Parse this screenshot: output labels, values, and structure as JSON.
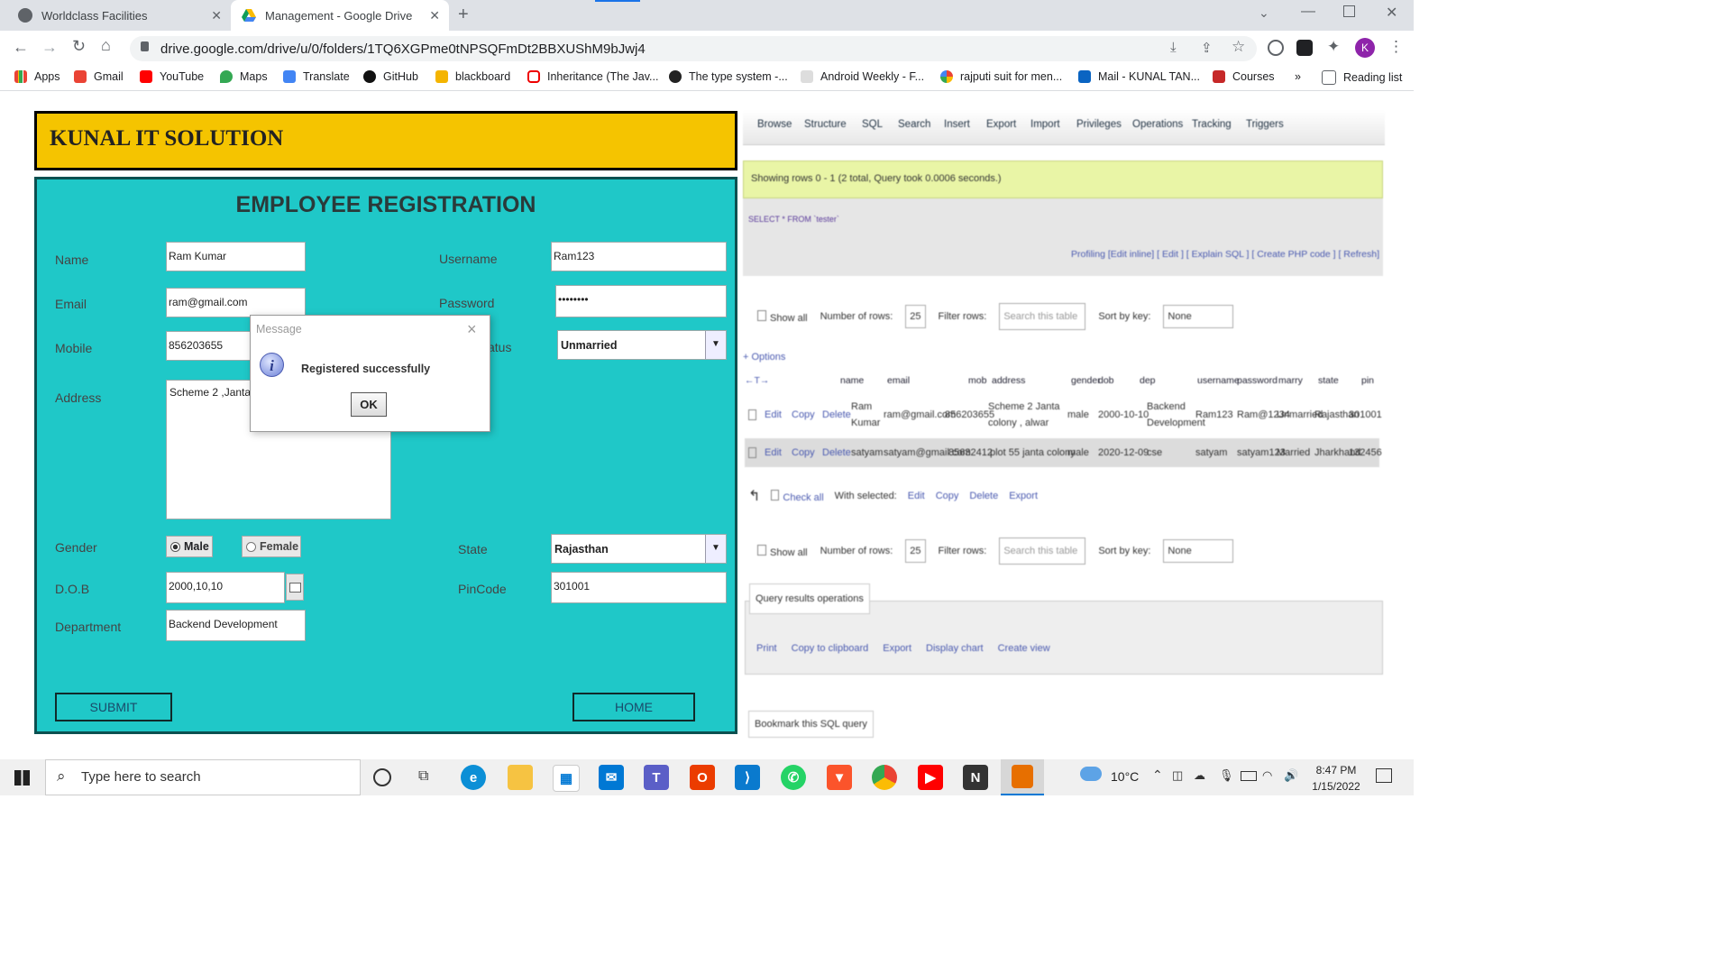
{
  "browser": {
    "tabs": [
      {
        "title": "Worldclass Facilities",
        "active": false
      },
      {
        "title": "Management - Google Drive",
        "active": true
      }
    ],
    "url": "drive.google.com/drive/u/0/folders/1TQ6XGPme0tNPSQFmDt2BBXUShM9bJwj4",
    "profile_initial": "K",
    "bookmarks": [
      "Apps",
      "Gmail",
      "YouTube",
      "Maps",
      "Translate",
      "GitHub",
      "blackboard",
      "Inheritance (The Jav...",
      "The type system -...",
      "Android Weekly - F...",
      "rajputi suit for men...",
      "Mail - KUNAL TAN...",
      "Courses"
    ],
    "reading_list": "Reading list",
    "more": "»"
  },
  "app": {
    "company": "KUNAL IT SOLUTION",
    "form_title": "EMPLOYEE REGISTRATION",
    "labels": {
      "name": "Name",
      "email": "Email",
      "mobile": "Mobile",
      "address": "Address",
      "gender": "Gender",
      "dob": "D.O.B",
      "department": "Department",
      "username": "Username",
      "password": "Password",
      "status": "atus",
      "state": "State",
      "pincode": "PinCode"
    },
    "values": {
      "name": "Ram Kumar",
      "email": "ram@gmail.com",
      "mobile": "856203655",
      "address": "Scheme 2 ,Janta",
      "dob": "2000,10,10",
      "department": "Backend Development",
      "username": "Ram123",
      "password": "••••••••",
      "status": "Unmarried",
      "state": "Rajasthan",
      "pincode": "301001"
    },
    "gender_male": "Male",
    "gender_female": "Female",
    "submit": "SUBMIT",
    "home": "HOME"
  },
  "dialog": {
    "title": "Message",
    "message": "Registered successfully",
    "ok": "OK",
    "close": "×"
  },
  "pma": {
    "tabs": [
      "Browse",
      "Structure",
      "SQL",
      "Search",
      "Insert",
      "Export",
      "Import",
      "Privileges",
      "Operations",
      "Tracking",
      "Triggers"
    ],
    "status": "Showing rows 0 - 1 (2 total, Query took 0.0006 seconds.)",
    "query": "SELECT * FROM `tester`",
    "links": "Profiling [Edit inline] [ Edit ] [ Explain SQL ] [ Create PHP code ] [ Refresh]",
    "show_all": "Show all",
    "num_rows_label": "Number of rows:",
    "num_rows": "25",
    "filter_label": "Filter rows:",
    "filter_placeholder": "Search this table",
    "sort_label": "Sort by key:",
    "sort_value": "None",
    "options": "+ Options",
    "columns": [
      "name",
      "email",
      "mob",
      "address",
      "gender",
      "dob",
      "dep",
      "username",
      "password",
      "marry",
      "state",
      "pin"
    ],
    "rows": [
      [
        "Ram Kumar",
        "ram@gmail.com",
        "856203655",
        "Scheme 2 Janta colony , alwar",
        "male",
        "2000-10-10",
        "Backend Development",
        "Ram123",
        "Ram@1234",
        "Unmarried",
        "Rajasthan",
        "301001"
      ],
      [
        "satyam",
        "satyam@gmail.com",
        "85632412",
        "plot 55 janta colony",
        "male",
        "2020-12-09",
        "cse",
        "satyam",
        "satyam123",
        "Married",
        "Jharkhand",
        "132456"
      ]
    ],
    "row_actions": [
      "Edit",
      "Copy",
      "Delete"
    ],
    "check_all": "Check all",
    "with_selected": "With selected:",
    "bulk_actions": [
      "Edit",
      "Copy",
      "Delete",
      "Export"
    ],
    "qro_title": "Query results operations",
    "qro_actions": [
      "Print",
      "Copy to clipboard",
      "Export",
      "Display chart",
      "Create view"
    ],
    "bookmark": "Bookmark this SQL query"
  },
  "taskbar": {
    "search_placeholder": "Type here to search",
    "weather": "10°C",
    "time": "8:47 PM",
    "date": "1/15/2022"
  }
}
